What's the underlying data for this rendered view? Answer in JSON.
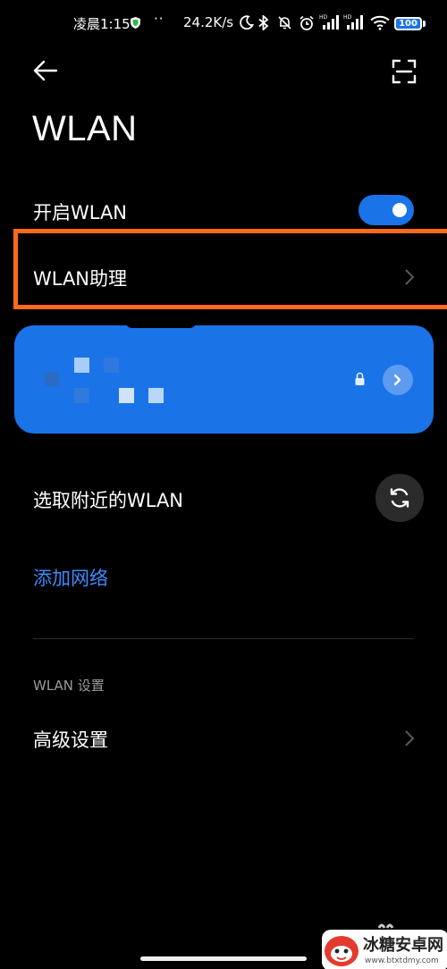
{
  "status_bar": {
    "time": "凌晨1:15",
    "dots": "··",
    "net_speed": "24.2K/s",
    "signal_badge_1": "HD",
    "signal_badge_2": "HD",
    "battery_level": "100"
  },
  "header": {
    "title": "WLAN"
  },
  "wlan_toggle": {
    "label": "开启WLAN",
    "on": true
  },
  "wlan_assistant": {
    "label": "WLAN助理",
    "highlight_color": "#ff6a1a"
  },
  "connected_network": {
    "name_obscured": true,
    "secured": true,
    "card_color": "#1b73e8"
  },
  "nearby": {
    "label": "选取附近的WLAN"
  },
  "add_network": {
    "label": "添加网络",
    "color": "#3d8bff"
  },
  "settings_section": {
    "header": "WLAN 设置",
    "advanced_label": "高级设置"
  },
  "watermark": {
    "brand": "冰糖安卓网",
    "url": "www.btxtdmy.com"
  }
}
